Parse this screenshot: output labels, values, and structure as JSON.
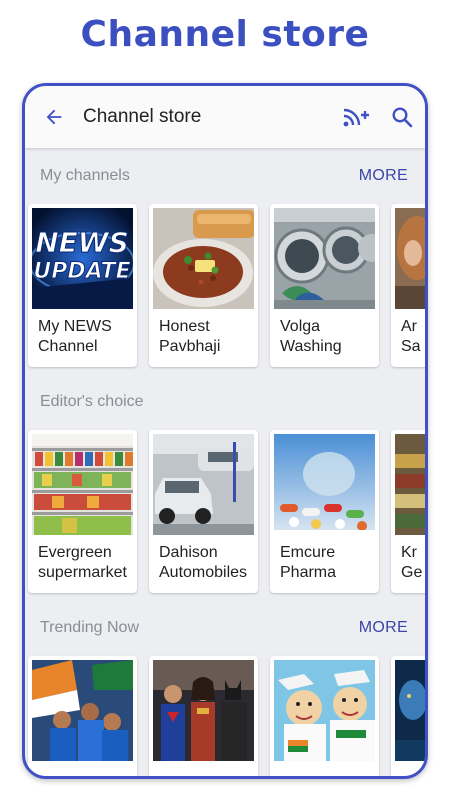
{
  "promo": {
    "title": "Channel store"
  },
  "appbar": {
    "title": "Channel store"
  },
  "sections": [
    {
      "title": "My channels",
      "more": "MORE",
      "cards": [
        {
          "label": "My NEWS\nChannel",
          "image": "news-update"
        },
        {
          "label": "Honest\nPavbhaji",
          "image": "pavbhaji"
        },
        {
          "label": "Volga\nWashing",
          "image": "washing-machines"
        },
        {
          "label": "Ar\nSa",
          "image": "salon"
        }
      ]
    },
    {
      "title": "Editor's choice",
      "more": "",
      "cards": [
        {
          "label": "Evergreen\nsupermarket",
          "image": "supermarket-shelves"
        },
        {
          "label": "Dahison\nAutomobiles",
          "image": "car-garage"
        },
        {
          "label": "Emcure\nPharma",
          "image": "pills"
        },
        {
          "label": "Kr\nGe",
          "image": "store-shelves"
        }
      ]
    },
    {
      "title": "Trending Now",
      "more": "MORE",
      "cards": [
        {
          "label": "",
          "image": "cricket-team"
        },
        {
          "label": "",
          "image": "superheroes"
        },
        {
          "label": "",
          "image": "cartoon-politicians"
        },
        {
          "label": "",
          "image": "blue-movie"
        }
      ]
    }
  ],
  "news_graphic": {
    "line1": "NEWS",
    "line2": "UPDATE"
  },
  "colors": {
    "accent": "#3f51c5",
    "title": "#3b4fc0",
    "more": "#3a46a8",
    "background": "#edeef2"
  }
}
